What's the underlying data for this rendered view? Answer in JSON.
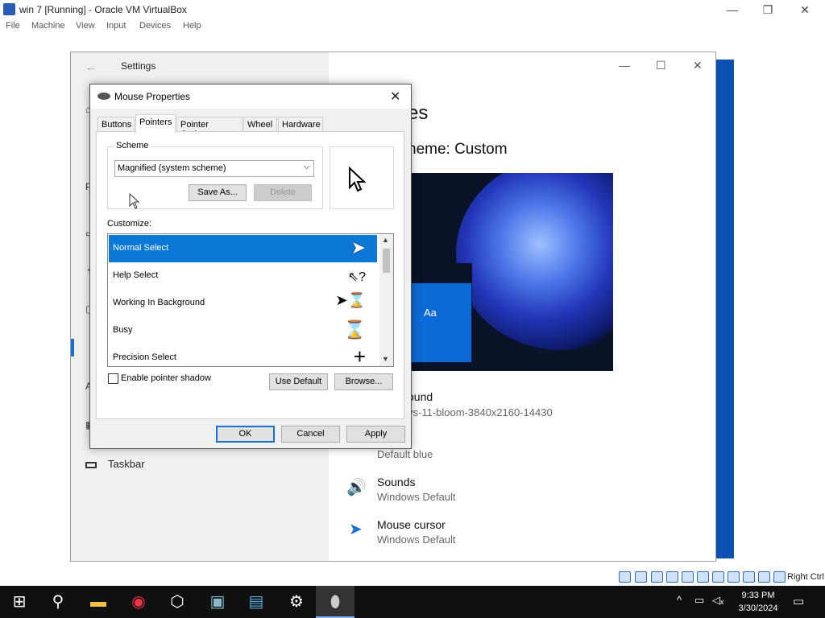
{
  "host": {
    "title": "win 7 [Running] - Oracle VM VirtualBox",
    "controls": {
      "minimize": "—",
      "maximize": "❐",
      "close": "✕"
    },
    "menu": [
      "File",
      "Machine",
      "View",
      "Input",
      "Devices",
      "Help"
    ],
    "status_host_key": "Right Ctrl"
  },
  "settings": {
    "back_icon": "←",
    "title": "Settings",
    "controls": {
      "minimize": "—",
      "maximize": "☐",
      "close": "✕"
    },
    "left_glyphs": [
      "⌂",
      "P",
      "▭",
      "◔",
      "▢",
      "A",
      "▦"
    ],
    "left_nav_taskbar": "Taskbar",
    "page_title": "es",
    "theme_label": "heme: Custom",
    "preview_label": "Aa",
    "rows": [
      {
        "title": "ound",
        "sub": "vs-11-bloom-3840x2160-14430"
      },
      {
        "title": "",
        "sub": "Default blue"
      },
      {
        "title": "Sounds",
        "sub": "Windows Default",
        "icon": "🔊"
      },
      {
        "title": "Mouse cursor",
        "sub": "Windows Default",
        "icon": "➤"
      }
    ]
  },
  "mouse_props": {
    "title": "Mouse Properties",
    "close": "✕",
    "tabs": [
      "Buttons",
      "Pointers",
      "Pointer Options",
      "Wheel",
      "Hardware"
    ],
    "active_tab": "Pointers",
    "scheme_label": "Scheme",
    "scheme_value": "Magnified (system scheme)",
    "save_as": "Save As...",
    "delete": "Delete",
    "customize_label": "Customize:",
    "list": [
      {
        "label": "Normal Select",
        "cursor": "➤"
      },
      {
        "label": "Help Select",
        "cursor": "⇖?"
      },
      {
        "label": "Working In Background",
        "cursor": "➤⌛"
      },
      {
        "label": "Busy",
        "cursor": "⌛"
      },
      {
        "label": "Precision Select",
        "cursor": "+"
      }
    ],
    "enable_shadow": "Enable pointer shadow",
    "use_default": "Use Default",
    "browse": "Browse...",
    "ok": "OK",
    "cancel": "Cancel",
    "apply": "Apply"
  },
  "taskbar": {
    "clock_time": "9:33 PM",
    "clock_date": "3/30/2024"
  },
  "colors": {
    "accent": "#0b77d6",
    "taskbar": "#101010"
  }
}
